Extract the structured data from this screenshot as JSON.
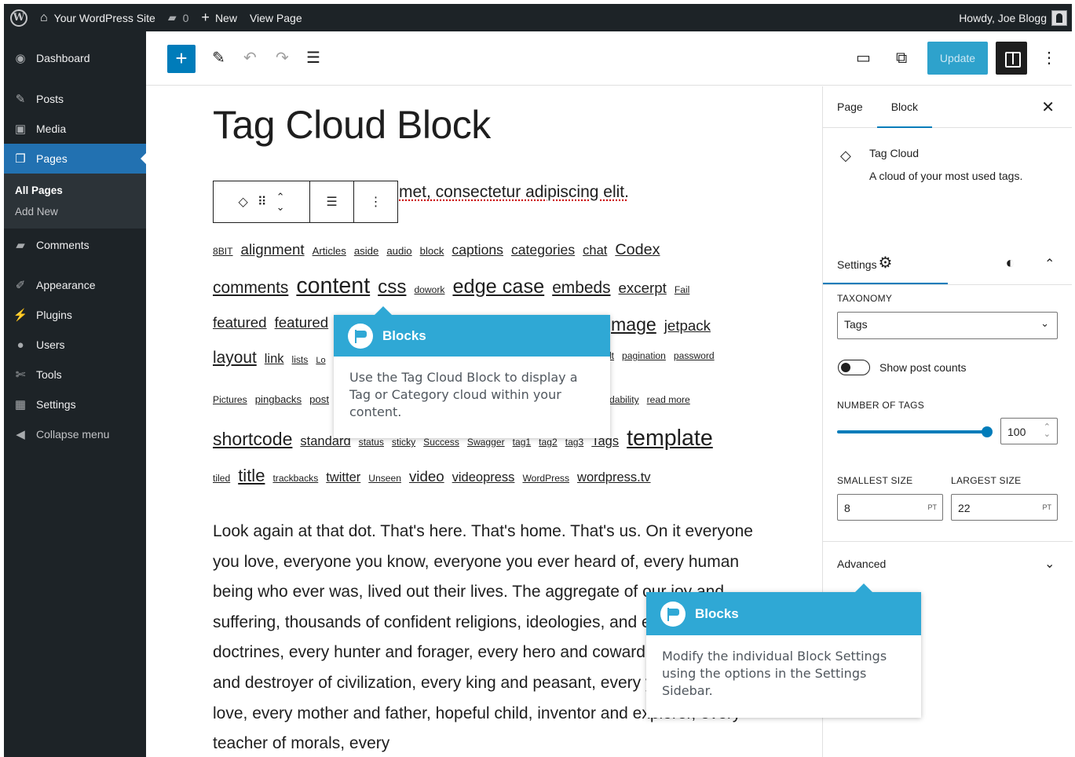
{
  "adminbar": {
    "site_name": "Your WordPress Site",
    "comments_count": "0",
    "new_label": "New",
    "view_page_label": "View Page",
    "howdy": "Howdy, Joe Blogg"
  },
  "menu": {
    "dashboard": "Dashboard",
    "posts": "Posts",
    "media": "Media",
    "pages": "Pages",
    "all_pages": "All Pages",
    "add_new": "Add New",
    "comments": "Comments",
    "appearance": "Appearance",
    "plugins": "Plugins",
    "users": "Users",
    "tools": "Tools",
    "settings": "Settings",
    "collapse": "Collapse menu"
  },
  "header": {
    "inserter": "+",
    "update_label": "Update"
  },
  "content": {
    "title": "Tag Cloud Block",
    "intro_fragment": "met, consectetur adipiscing elit.",
    "tag_rows": [
      [
        [
          "8BIT",
          11
        ],
        [
          "alignment",
          17
        ],
        [
          "Articles",
          12
        ],
        [
          "aside",
          12
        ],
        [
          "audio",
          12
        ],
        [
          "block",
          12
        ],
        [
          "captions",
          16
        ],
        [
          "categories",
          16
        ],
        [
          "chat",
          15
        ],
        [
          "Codex",
          18
        ]
      ],
      [
        [
          "comments",
          19
        ],
        [
          "content",
          26
        ],
        [
          "css",
          22
        ],
        [
          "dowork",
          11
        ],
        [
          "edge case",
          23
        ],
        [
          "embeds",
          19
        ],
        [
          "excerpt",
          17
        ],
        [
          "Fail",
          11
        ]
      ],
      [
        [
          "featured",
          17
        ],
        [
          "featured",
          17
        ]
      ],
      [
        [
          "layout",
          19
        ],
        [
          "link",
          15
        ],
        [
          "lists",
          11
        ],
        [
          "Lo",
          10
        ]
      ],
      [
        [
          "Pictures",
          11
        ],
        [
          "pingbacks",
          12
        ],
        [
          "post",
          12
        ]
      ],
      [
        [
          "shortcode",
          21
        ],
        [
          "standard",
          15
        ],
        [
          "status",
          11
        ],
        [
          "sticky",
          11
        ],
        [
          "Success",
          11
        ],
        [
          "Swagger",
          11
        ],
        [
          "tag1",
          11
        ],
        [
          "tag2",
          11
        ],
        [
          "tag3",
          11
        ],
        [
          "Tags",
          15
        ],
        [
          "template",
          26
        ]
      ],
      [
        [
          "tiled",
          11
        ],
        [
          "title",
          20
        ],
        [
          "trackbacks",
          11
        ],
        [
          "twitter",
          15
        ],
        [
          "Unseen",
          11
        ],
        [
          "video",
          17
        ],
        [
          "videopress",
          15
        ],
        [
          "WordPress",
          11
        ],
        [
          "wordpress.tv",
          15
        ]
      ]
    ],
    "tag_row_right": [
      {
        "row": 2,
        "tags": [
          [
            "mage",
            21
          ],
          [
            "jetpack",
            17
          ]
        ]
      },
      {
        "row": 3,
        "tags": [
          [
            "lt",
            11
          ],
          [
            "pagination",
            11
          ],
          [
            "password",
            11
          ]
        ]
      },
      {
        "row": 4,
        "tags": [
          [
            "dability",
            11
          ],
          [
            "read more",
            11
          ]
        ]
      }
    ],
    "paragraph": "Look again at that dot. That's here. That's home. That's us. On it everyone you love, everyone you know, everyone you ever heard of, every human being who ever was, lived out their lives. The aggregate of our joy and suffering, thousands of confident religions, ideologies, and economic doctrines, every hunter and forager, every hero and coward, every creator and destroyer of civilization, every king and peasant, every young couple in love, every mother and father, hopeful child, inventor and explorer, every teacher of morals, every"
  },
  "tooltips": {
    "first_title": "Blocks",
    "first_body": "Use the Tag Cloud Block to display a Tag or Category cloud within your content.",
    "second_title": "Blocks",
    "second_body": "Modify the individual Block Settings using the options in the Settings Sidebar."
  },
  "sidebar": {
    "tab_page": "Page",
    "tab_block": "Block",
    "block_name": "Tag Cloud",
    "block_desc": "A cloud of your most used tags.",
    "settings_heading": "Settings",
    "taxonomy_label": "TAXONOMY",
    "taxonomy_value": "Tags",
    "show_counts_label": "Show post counts",
    "number_label": "NUMBER OF TAGS",
    "number_value": "100",
    "number_fraction": 1.0,
    "smallest_label": "SMALLEST SIZE",
    "smallest_value": "8",
    "largest_label": "LARGEST SIZE",
    "largest_value": "22",
    "unit": "PT",
    "advanced_heading": "Advanced"
  },
  "colors": {
    "accent": "#007cba",
    "tooltip": "#2fa8d5",
    "admin_dark": "#1d2327",
    "current_menu": "#2271b1"
  }
}
